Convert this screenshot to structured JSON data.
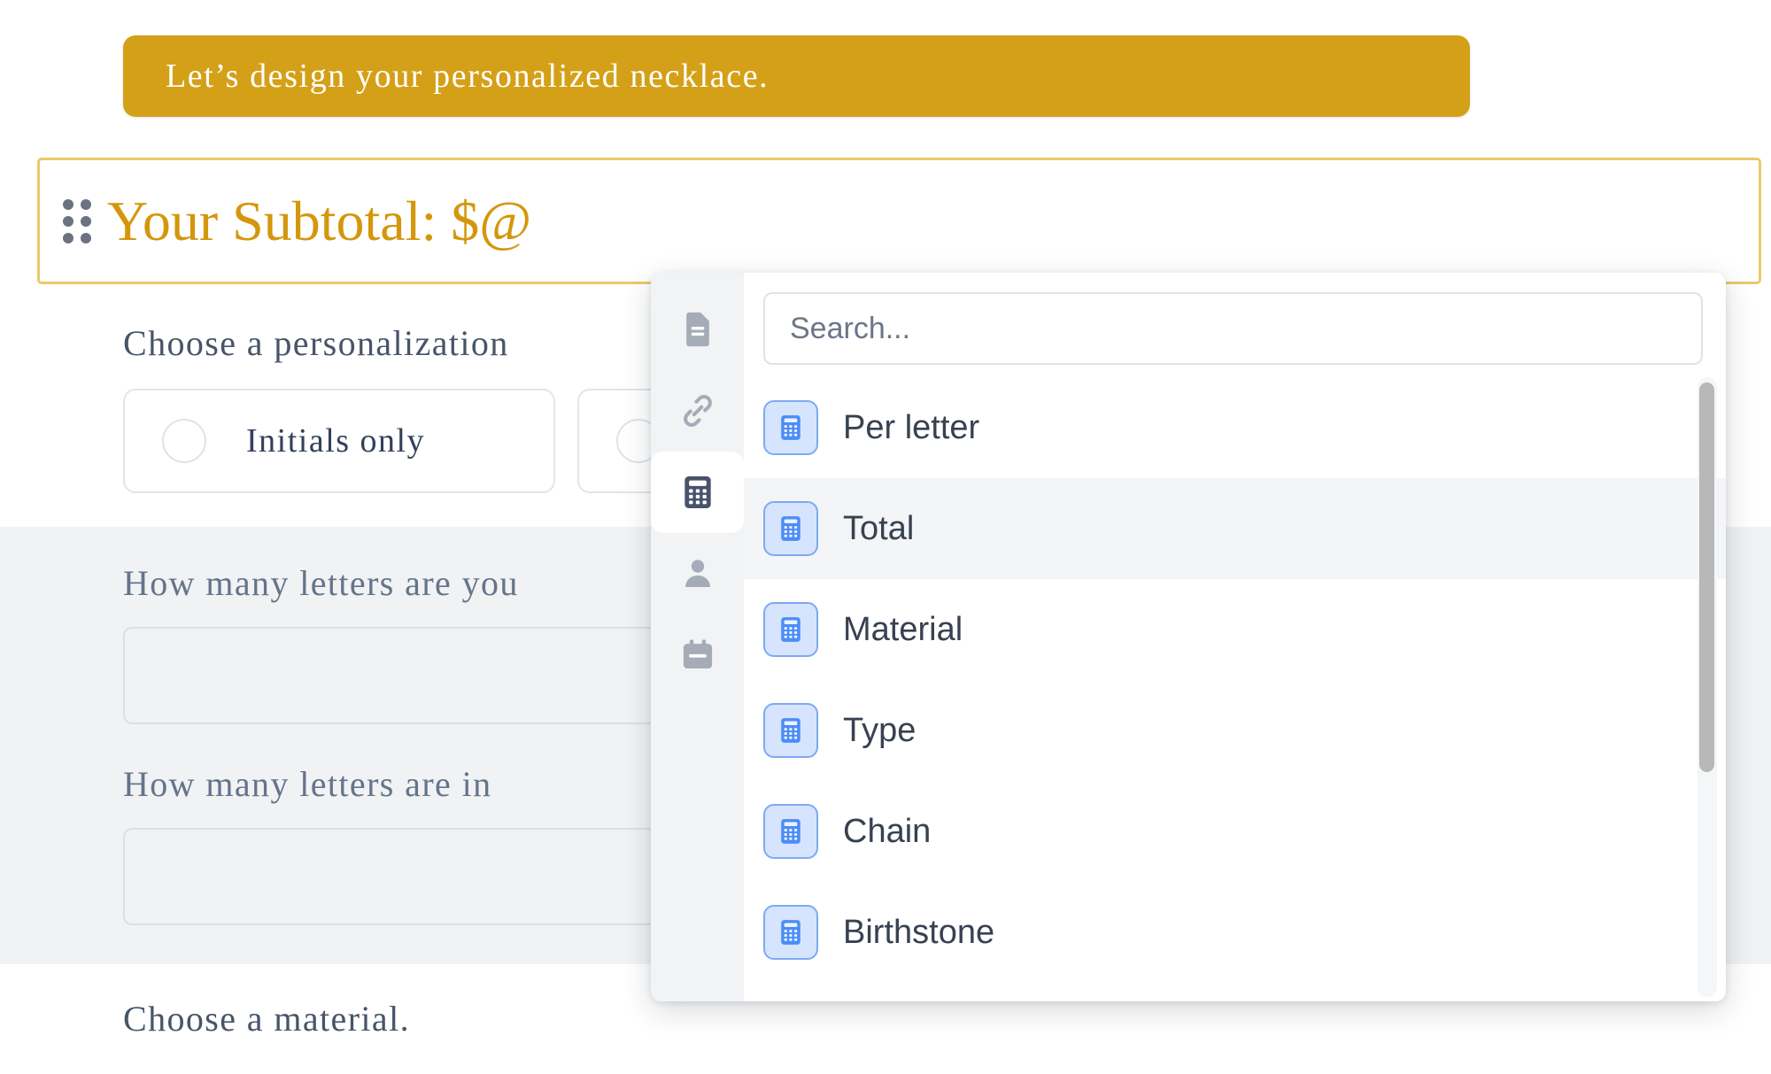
{
  "banner": {
    "text": "Let’s design your personalized necklace."
  },
  "subtotal": {
    "drag_handle_icon": "drag-dots-icon",
    "label": "Your Subtotal: $@",
    "border_color": "#ebc969",
    "text_color": "#d4970c"
  },
  "form": {
    "personalization": {
      "label": "Choose a personalization",
      "options": [
        {
          "label": "Initials only"
        },
        {
          "label": ""
        }
      ]
    },
    "questions": [
      {
        "label": "How many letters are you",
        "value": "",
        "placeholder": ""
      },
      {
        "label": "How many letters are in",
        "value": "",
        "placeholder": ""
      }
    ],
    "material": {
      "label": "Choose a material."
    }
  },
  "dropdown": {
    "search": {
      "value": "",
      "placeholder": "Search...",
      "icon": "search-input"
    },
    "rail": [
      {
        "icon": "document-icon",
        "name": "document",
        "active": false
      },
      {
        "icon": "link-icon",
        "name": "link",
        "active": false
      },
      {
        "icon": "calculator-icon",
        "name": "calculator",
        "active": true
      },
      {
        "icon": "person-icon",
        "name": "person",
        "active": false
      },
      {
        "icon": "calendar-icon",
        "name": "calendar",
        "active": false
      }
    ],
    "items": [
      {
        "label": "Per letter",
        "icon": "calculator-icon",
        "selected": false
      },
      {
        "label": "Total",
        "icon": "calculator-icon",
        "selected": true
      },
      {
        "label": "Material",
        "icon": "calculator-icon",
        "selected": false
      },
      {
        "label": "Type",
        "icon": "calculator-icon",
        "selected": false
      },
      {
        "label": "Chain",
        "icon": "calculator-icon",
        "selected": false
      },
      {
        "label": "Birthstone",
        "icon": "calculator-icon",
        "selected": false
      }
    ],
    "accent_color": "#4b8df8",
    "badge_bg": "#d6e4fd"
  }
}
